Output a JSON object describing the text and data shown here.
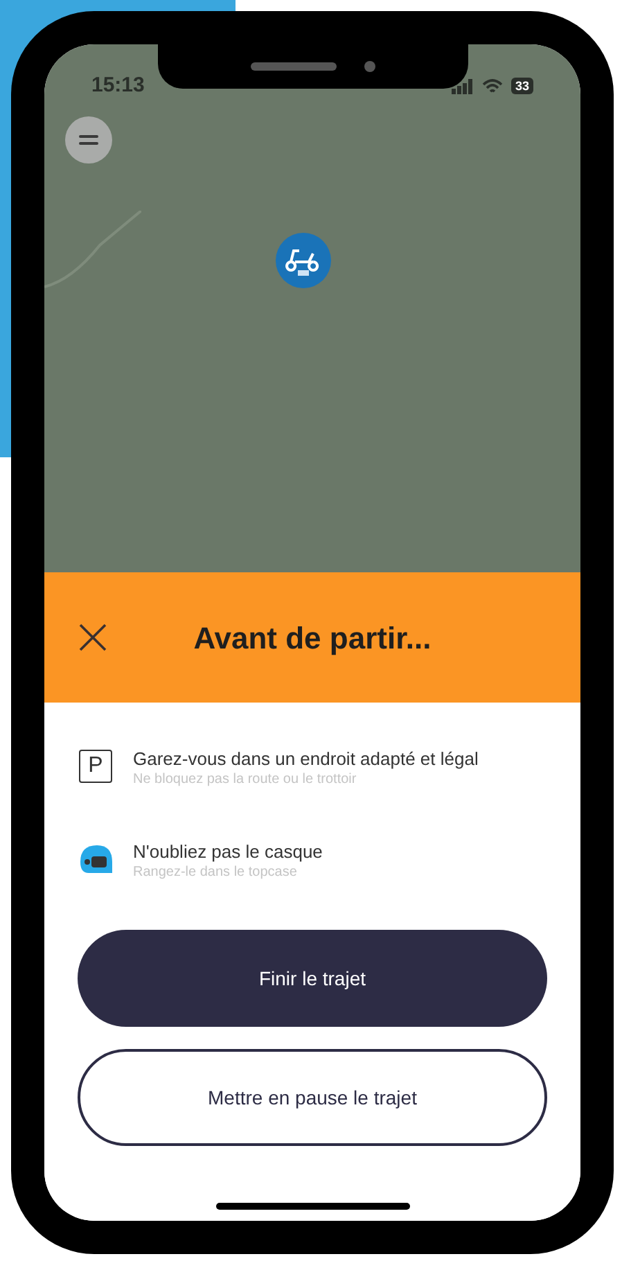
{
  "status_bar": {
    "time": "15:13",
    "battery": "33"
  },
  "sheet": {
    "title": "Avant de partir...",
    "tips": [
      {
        "kind": "parking",
        "icon_text": "P",
        "title": "Garez-vous dans un endroit adapté et légal",
        "subtitle": "Ne bloquez pas la route ou le trottoir"
      },
      {
        "kind": "helmet",
        "title": "N'oubliez pas le casque",
        "subtitle": "Rangez-le dans le topcase"
      }
    ],
    "buttons": [
      {
        "kind": "primary",
        "label": "Finir le trajet"
      },
      {
        "kind": "secondary",
        "label": "Mettre en pause le trajet"
      }
    ]
  }
}
